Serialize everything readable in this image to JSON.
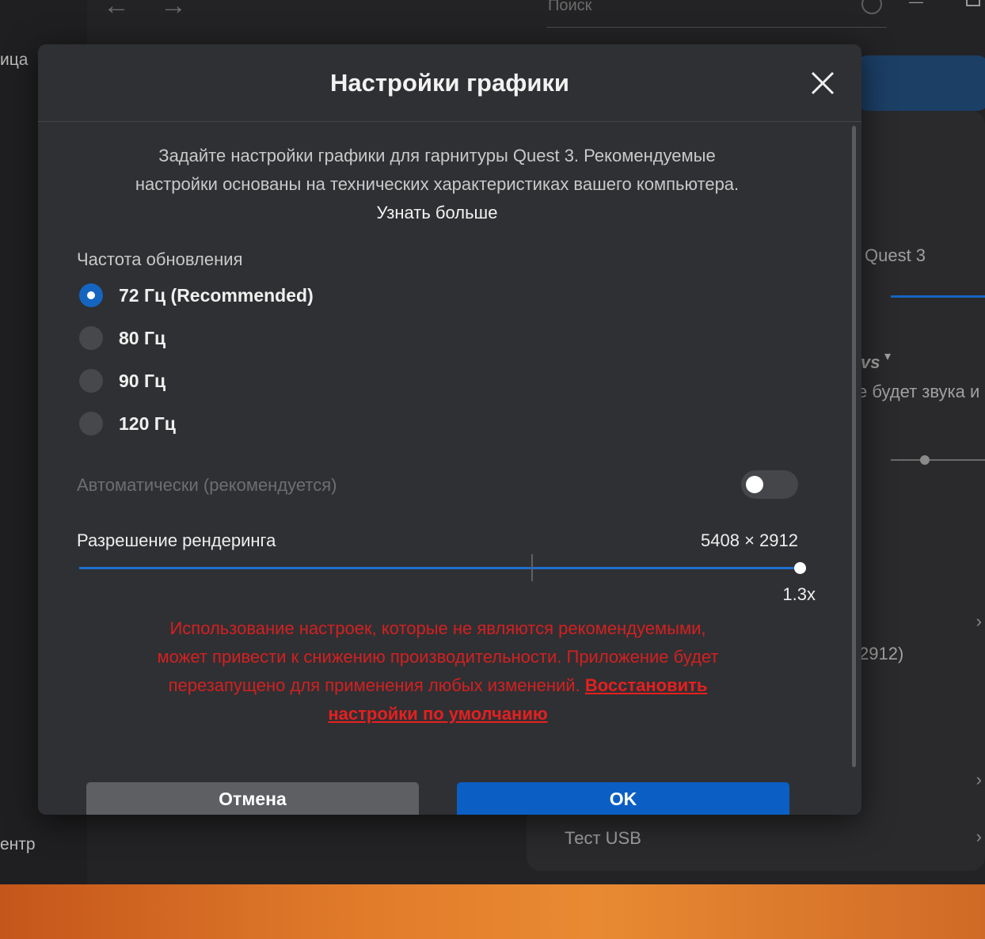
{
  "background": {
    "search_placeholder": "Поиск",
    "sidebar_items": [
      "ица",
      "ентр"
    ],
    "headset_name": "Quest 3",
    "dropdown_partial": "vs",
    "audio_note_partial": "е будет звука и",
    "resolution_partial": "2912)",
    "usb_test": "Тест USB"
  },
  "dialog": {
    "title": "Настройки графики",
    "intro_text": "Задайте настройки графики для гарнитуры Quest 3. Рекомендуемые настройки основаны на технических характеристиках вашего компьютера.",
    "learn_more": "Узнать больше",
    "refresh_rate": {
      "label": "Частота обновления",
      "options": [
        {
          "label": "72 Гц (Recommended)",
          "selected": true
        },
        {
          "label": "80 Гц",
          "selected": false
        },
        {
          "label": "90 Гц",
          "selected": false
        },
        {
          "label": "120 Гц",
          "selected": false
        }
      ]
    },
    "auto": {
      "label": "Автоматически (рекомендуется)",
      "enabled": false
    },
    "render_resolution": {
      "label": "Разрешение рендеринга",
      "value": "5408 × 2912",
      "scale_label": "1.3x",
      "slider_fraction": 1.0,
      "default_fraction": 0.627
    },
    "warning_text": "Использование настроек, которые не являются рекомендуемыми, может привести к снижению производительности. Приложение будет перезапущено для применения любых изменений.",
    "restore_defaults": "Восстановить настройки по умолчанию",
    "cancel_label": "Отмена",
    "ok_label": "OK"
  },
  "colors": {
    "accent": "#1565c0",
    "warning": "#d32021",
    "dialog_bg": "#2f3033"
  }
}
